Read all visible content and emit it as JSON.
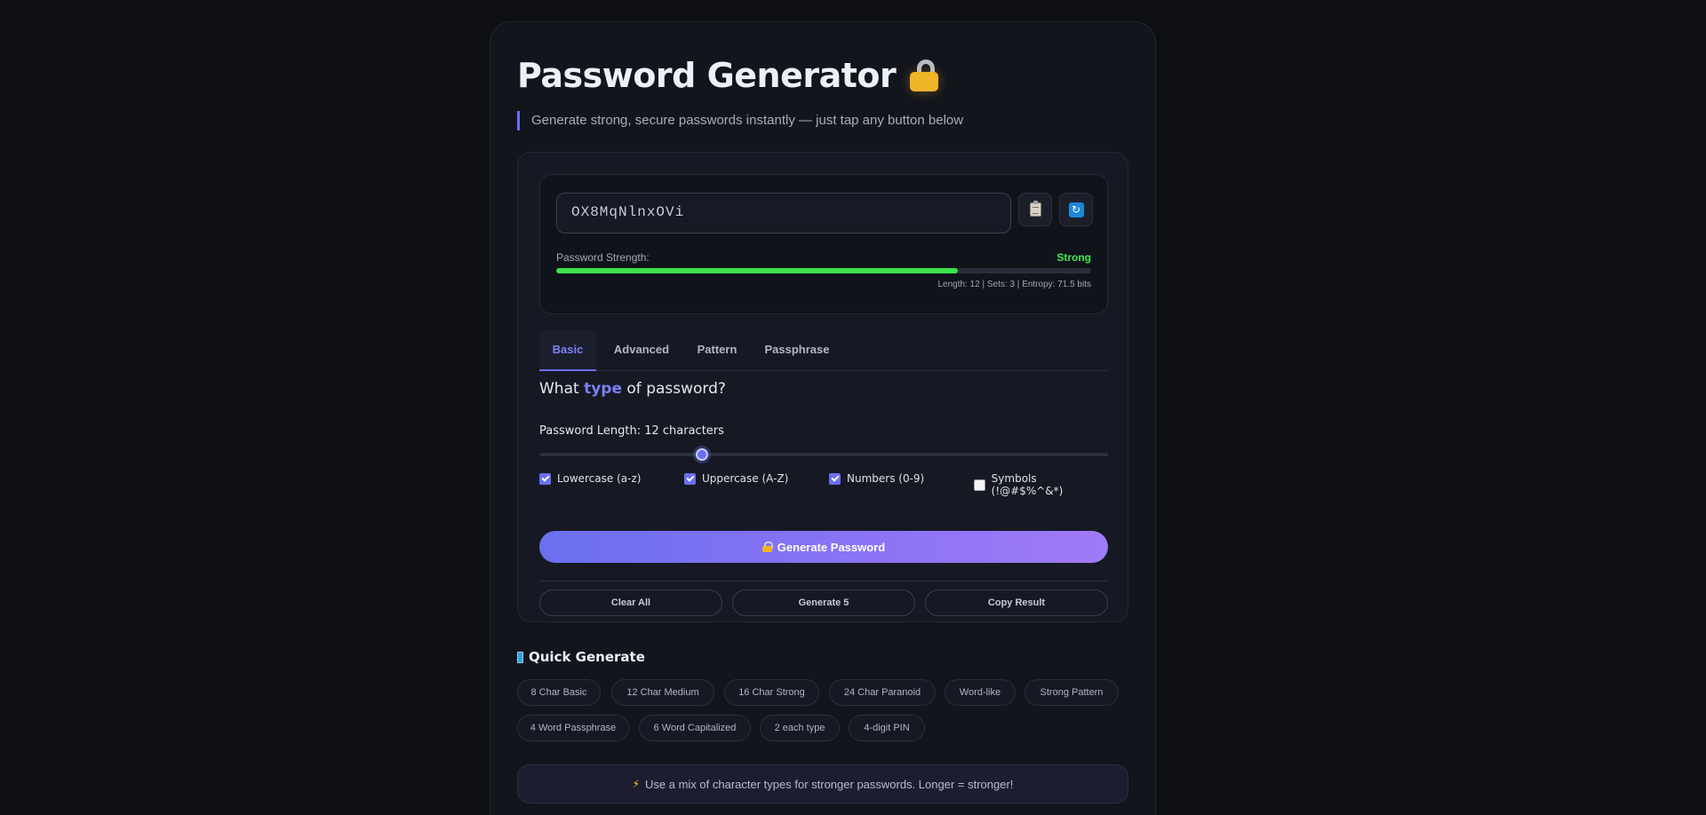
{
  "header": {
    "title": "Password Generator",
    "subtitle": "Generate strong, secure passwords instantly — just tap any button below"
  },
  "output": {
    "password": "OX8MqNlnxOVi",
    "strength_label": "Password Strength:",
    "strength_value": "Strong",
    "strength_fraction": 0.75,
    "strength_color": "#3be24a",
    "info": "Length: 12 | Sets: 3 | Entropy: 71.5 bits",
    "copy_icon": "clipboard-icon",
    "refresh_icon": "refresh-icon"
  },
  "tabs": [
    {
      "label": "Basic",
      "active": true
    },
    {
      "label": "Advanced",
      "active": false
    },
    {
      "label": "Pattern",
      "active": false
    },
    {
      "label": "Passphrase",
      "active": false
    }
  ],
  "basic": {
    "question_pre": "What ",
    "question_accent": "type",
    "question_post": " of password?",
    "length_label": "Password Length: 12 characters",
    "length_value": 12,
    "length_min": 4,
    "length_max": 32,
    "options": [
      {
        "label": "Lowercase (a-z)",
        "checked": true
      },
      {
        "label": "Uppercase (A-Z)",
        "checked": true
      },
      {
        "label": "Numbers (0-9)",
        "checked": true
      },
      {
        "label": "Symbols (!@#$%^&*)",
        "checked": false
      }
    ],
    "generate_label": "Generate Password",
    "actions": [
      "Clear All",
      "Generate 5",
      "Copy Result"
    ]
  },
  "quick": {
    "title": "Quick Generate",
    "row1": [
      "8 Char Basic",
      "12 Char Medium",
      "16 Char Strong",
      "24 Char Paranoid",
      "Word-like",
      "Strong Pattern"
    ],
    "row2": [
      "4 Word Passphrase",
      "6 Word Capitalized",
      "2 each type",
      "4-digit PIN"
    ]
  },
  "tip": "Use a mix of character types for stronger passwords. Longer = stronger!",
  "colors": {
    "accent": "#6a6ff0",
    "strong": "#3ee94d",
    "background": "#0d0f14"
  }
}
